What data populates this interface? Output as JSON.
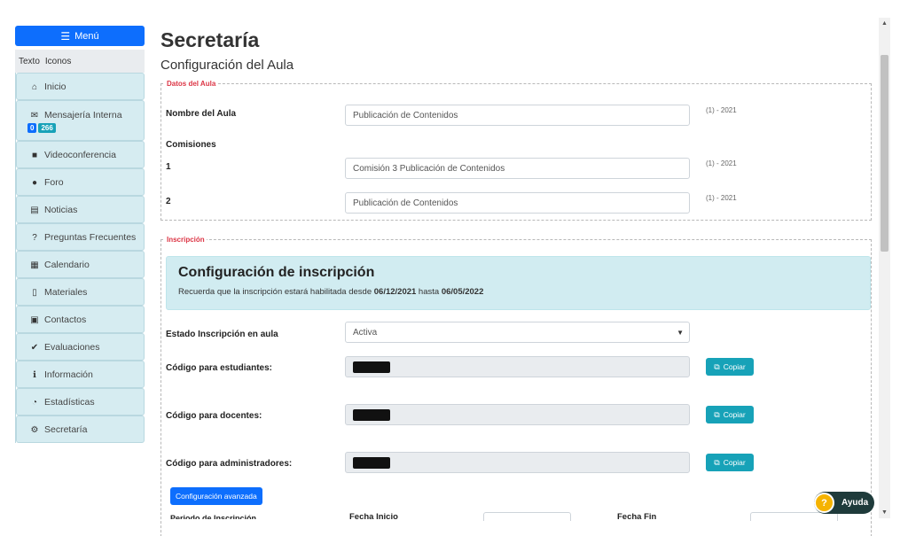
{
  "sidebar": {
    "menu_label": "Menú",
    "view_toggle": {
      "text": "Texto",
      "icons": "Iconos"
    },
    "items": [
      {
        "label": "Inicio",
        "icon": "home-icon"
      },
      {
        "label": "Mensajería Interna",
        "icon": "envelope-icon",
        "badges": [
          "0",
          "266"
        ]
      },
      {
        "label": "Videoconferencia",
        "icon": "video-icon"
      },
      {
        "label": "Foro",
        "icon": "comments-icon"
      },
      {
        "label": "Noticias",
        "icon": "newspaper-icon"
      },
      {
        "label": "Preguntas Frecuentes",
        "icon": "question-circle-icon"
      },
      {
        "label": "Calendario",
        "icon": "calendar-icon"
      },
      {
        "label": "Materiales",
        "icon": "file-icon"
      },
      {
        "label": "Contactos",
        "icon": "address-book-icon"
      },
      {
        "label": "Evaluaciones",
        "icon": "check-circle-icon"
      },
      {
        "label": "Información",
        "icon": "info-circle-icon"
      },
      {
        "label": "Estadísticas",
        "icon": "chart-pie-icon"
      },
      {
        "label": "Secretaría",
        "icon": "cogs-icon"
      }
    ]
  },
  "main": {
    "title": "Secretaría",
    "subtitle": "Configuración del Aula",
    "datos": {
      "legend": "Datos del Aula",
      "nombre_label": "Nombre del Aula",
      "nombre_value": "Publicación de Contenidos",
      "nombre_hint": "(1) - 2021",
      "comisiones_label": "Comisiones",
      "comisiones": [
        {
          "num": "1",
          "value": "Comisión 3 Publicación de Contenidos",
          "hint": "(1) - 2021"
        },
        {
          "num": "2",
          "value": "Publicación de Contenidos",
          "hint": "(1) - 2021"
        }
      ]
    },
    "inscripcion": {
      "legend": "Inscripción",
      "box_title": "Configuración de inscripción",
      "box_text_prefix": "Recuerda que la inscripción estará habilitada desde ",
      "date_from": "06/12/2021",
      "box_text_mid": " hasta ",
      "date_to": "06/05/2022",
      "estado_label": "Estado Inscripción en aula",
      "estado_value": "Activa",
      "codigo_estudiantes_label": "Código para estudiantes:",
      "codigo_docentes_label": "Código para docentes:",
      "codigo_admin_label": "Código para administradores:",
      "copy_label": "Copiar",
      "advanced_label": "Configuración avanzada",
      "periodo_label": "Periodo de Inscripción",
      "fecha_inicio_label": "Fecha Inicio",
      "fecha_fin_label": "Fecha Fin"
    }
  },
  "help": {
    "label": "Ayuda"
  }
}
